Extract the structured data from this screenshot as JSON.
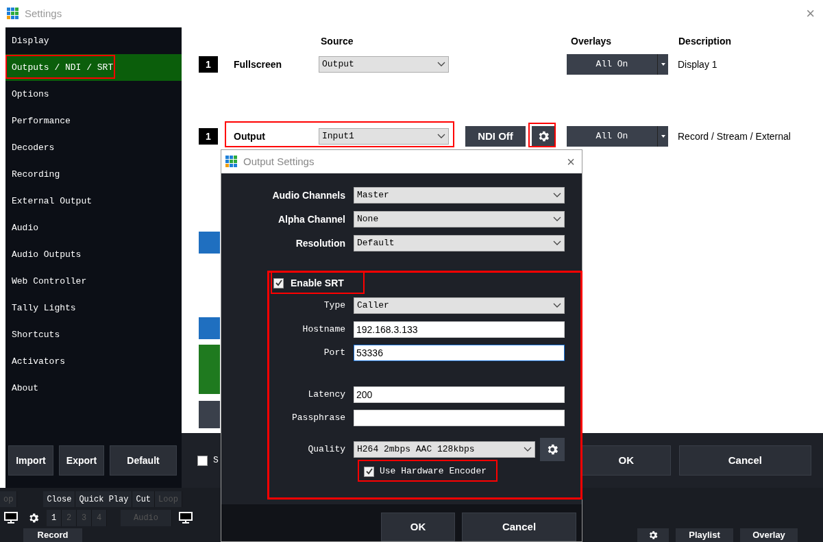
{
  "window": {
    "title": "Settings",
    "close": "×"
  },
  "sidebar": {
    "items": [
      {
        "label": "Display",
        "selected": false
      },
      {
        "label": "Outputs / NDI / SRT",
        "selected": true
      },
      {
        "label": "Options",
        "selected": false
      },
      {
        "label": "Performance",
        "selected": false
      },
      {
        "label": "Decoders",
        "selected": false
      },
      {
        "label": "Recording",
        "selected": false
      },
      {
        "label": "External Output",
        "selected": false
      },
      {
        "label": "Audio",
        "selected": false
      },
      {
        "label": "Audio Outputs",
        "selected": false
      },
      {
        "label": "Web Controller",
        "selected": false
      },
      {
        "label": "Tally Lights",
        "selected": false
      },
      {
        "label": "Shortcuts",
        "selected": false
      },
      {
        "label": "Activators",
        "selected": false
      },
      {
        "label": "About",
        "selected": false
      }
    ],
    "buttons": [
      "Import",
      "Export",
      "Default"
    ]
  },
  "outputs": {
    "columns": [
      "Source",
      "Overlays",
      "Description"
    ],
    "rows": [
      {
        "kind": "display",
        "number": "1",
        "name": "Fullscreen",
        "source": "Output",
        "overlays": "All On",
        "description": "Display 1"
      },
      {
        "kind": "output",
        "number": "1",
        "name": "Output",
        "source": "Input1",
        "ndi": "NDI Off",
        "overlays": "All On",
        "description": "Record / Stream / External"
      }
    ]
  },
  "footer": {
    "checkbox": {
      "label": "S",
      "checked": false
    },
    "buttons": [
      "OK",
      "Cancel"
    ]
  },
  "dialog": {
    "title": "Output Settings",
    "close": "×",
    "fields": [
      {
        "kind": "select",
        "label": "Audio Channels",
        "value": "Master"
      },
      {
        "kind": "select",
        "label": "Alpha Channel",
        "value": "None"
      },
      {
        "kind": "select",
        "label": "Resolution",
        "value": "Default"
      }
    ],
    "srt": {
      "label": "Enable SRT",
      "checked": true,
      "fields": [
        {
          "kind": "select",
          "label": "Type",
          "value": "Caller"
        },
        {
          "kind": "input",
          "label": "Hostname",
          "value": "192.168.3.133",
          "focused": false
        },
        {
          "kind": "input",
          "label": "Port",
          "value": "53336",
          "focused": true
        },
        {
          "kind": "input",
          "label": "Latency",
          "value": "200",
          "focused": false
        },
        {
          "kind": "input",
          "label": "Passphrase",
          "focused": false
        },
        {
          "kind": "select",
          "label": "Quality",
          "value": "H264 2mbps AAC 128kbps"
        }
      ],
      "hardware_encoder": {
        "label": "Use Hardware Encoder",
        "checked": true
      }
    },
    "buttons": [
      "OK",
      "Cancel"
    ]
  },
  "toolbar": {
    "row_1": [
      {
        "label": "op",
        "disabled": true
      },
      {
        "label": "Close",
        "disabled": false
      },
      {
        "label": "Quick Play",
        "disabled": false
      },
      {
        "label": "Cut",
        "disabled": false
      },
      {
        "label": "Loop",
        "disabled": true
      }
    ],
    "row_2": [
      {
        "label": "1",
        "disabled": false
      },
      {
        "label": "2",
        "disabled": true
      },
      {
        "label": "3",
        "disabled": true
      },
      {
        "label": "4",
        "disabled": true
      },
      {
        "label": "Audio",
        "disabled": true
      }
    ],
    "bottom_left": [
      "Record"
    ],
    "bottom_right": [
      "Playlist",
      "Overlay"
    ]
  }
}
